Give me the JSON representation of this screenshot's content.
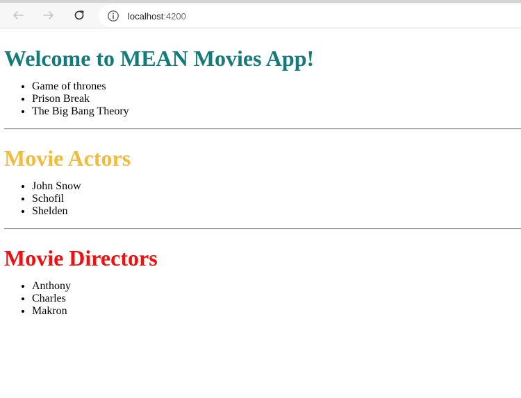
{
  "browser": {
    "url_host": "localhost",
    "url_port": ":4200",
    "icons": {
      "back": "arrow-left-icon",
      "forward": "arrow-right-icon",
      "reload": "reload-icon",
      "info": "info-icon"
    }
  },
  "colors": {
    "heading_welcome": "#137b7b",
    "heading_actors": "#f1bc3c",
    "heading_directors": "#f01010"
  },
  "sections": {
    "shows": {
      "title": "Welcome to MEAN Movies App!",
      "items": [
        "Game of thrones",
        "Prison Break",
        "The Big Bang Theory"
      ]
    },
    "actors": {
      "title": "Movie Actors",
      "items": [
        "John Snow",
        "Schofil",
        "Shelden"
      ]
    },
    "directors": {
      "title": "Movie Directors",
      "items": [
        "Anthony",
        "Charles",
        "Makron"
      ]
    }
  }
}
